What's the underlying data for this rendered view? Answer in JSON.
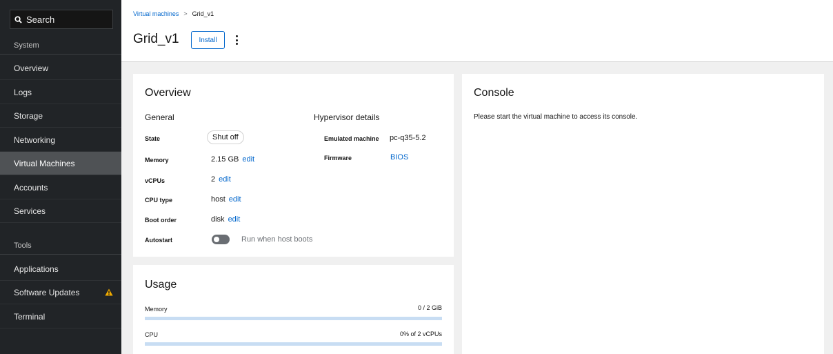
{
  "sidebar": {
    "search_label": "Search",
    "system_label": "System",
    "tools_label": "Tools",
    "system_items": [
      {
        "label": "Overview"
      },
      {
        "label": "Logs"
      },
      {
        "label": "Storage"
      },
      {
        "label": "Networking"
      },
      {
        "label": "Virtual Machines",
        "active": true
      },
      {
        "label": "Accounts"
      },
      {
        "label": "Services"
      }
    ],
    "tool_items": [
      {
        "label": "Applications"
      },
      {
        "label": "Software Updates",
        "badge_icon": "warning-icon"
      },
      {
        "label": "Terminal"
      }
    ],
    "warning_color": "#f0ab00"
  },
  "header": {
    "breadcrumb_parent": "Virtual machines",
    "breadcrumb_separator": ">",
    "breadcrumb_current": "Grid_v1",
    "title": "Grid_v1",
    "install_label": "Install"
  },
  "overview": {
    "title": "Overview",
    "general_heading": "General",
    "hypervisor_heading": "Hypervisor details",
    "state_label": "State",
    "state_value": "Shut off",
    "memory_label": "Memory",
    "memory_value": "2.15 GB",
    "vcpus_label": "vCPUs",
    "vcpus_value": "2",
    "cpu_type_label": "CPU type",
    "cpu_type_value": "host",
    "boot_order_label": "Boot order",
    "boot_order_value": "disk",
    "autostart_label": "Autostart",
    "autostart_toggle_label": "Run when host boots",
    "edit_label": "edit",
    "emulated_machine_label": "Emulated machine",
    "emulated_machine_value": "pc-q35-5.2",
    "firmware_label": "Firmware",
    "firmware_value": "BIOS"
  },
  "usage": {
    "title": "Usage",
    "memory_label": "Memory",
    "memory_value": "0 / 2 GiB",
    "memory_fraction": 0,
    "cpu_label": "CPU",
    "cpu_value": "0% of 2 vCPUs",
    "cpu_fraction": 0
  },
  "console": {
    "title": "Console",
    "message": "Please start the virtual machine to access its console."
  },
  "colors": {
    "accent": "#0066cc",
    "sidebar_bg": "#212427",
    "bar_track": "#c8ddf3"
  }
}
